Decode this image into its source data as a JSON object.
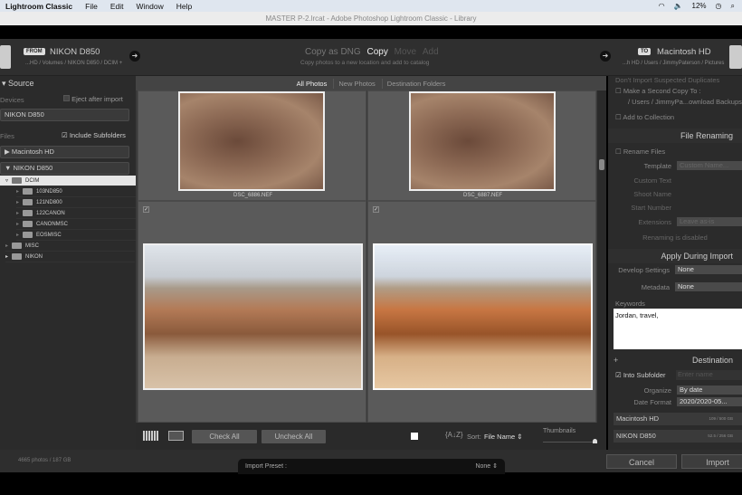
{
  "menubar": {
    "app": "Lightroom Classic",
    "items": [
      "File",
      "Edit",
      "Window",
      "Help"
    ],
    "battery": "12%"
  },
  "window_title": "MASTER P-2.lrcat - Adobe Photoshop Lightroom Classic - Library",
  "header": {
    "from_tag": "FROM",
    "from_source": "NIKON D850",
    "from_path": "...HD / Volumes / NIKON D850 / DCIM +",
    "modes": [
      "Copy as DNG",
      "Copy",
      "Move",
      "Add"
    ],
    "active_mode": "Copy",
    "mode_desc": "Copy photos to a new location and add to catalog",
    "to_tag": "TO",
    "to_dest": "Macintosh HD",
    "to_path": "...h HD / Users / JimmyPaterson / Pictures"
  },
  "source": {
    "title": "Source",
    "devices_label": "Devices",
    "eject_label": "Eject after import",
    "device": "NIKON D850",
    "files_label": "Files",
    "include_subfolders": "Include Subfolders",
    "include_checked": true,
    "volumes": [
      "Macintosh HD",
      "NIKON D850"
    ],
    "folders": [
      {
        "name": "DCIM",
        "level": 1,
        "selected": true
      },
      {
        "name": "103ND850",
        "level": 2
      },
      {
        "name": "121ND800",
        "level": 2
      },
      {
        "name": "122CANON",
        "level": 2
      },
      {
        "name": "CANONMSC",
        "level": 2
      },
      {
        "name": "EOSMISC",
        "level": 2
      },
      {
        "name": "MISC",
        "level": 1
      },
      {
        "name": "NIKON",
        "level": 1
      }
    ]
  },
  "grid": {
    "tabs": [
      "All Photos",
      "New Photos",
      "Destination Folders"
    ],
    "active_tab": "All Photos",
    "photos": [
      {
        "name": "DSC_6886.NEF",
        "checked": true
      },
      {
        "name": "DSC_6887.NEF",
        "checked": true
      },
      {
        "checked": true
      },
      {
        "checked": true
      }
    ]
  },
  "toolbar": {
    "check_all": "Check All",
    "uncheck_all": "Uncheck All",
    "sort_label": "Sort:",
    "sort_value": "File Name",
    "thumbnails": "Thumbnails"
  },
  "right": {
    "dup": "Don't Import Suspected Duplicates",
    "second_copy": "Make a Second Copy To :",
    "second_copy_path": "/ Users / JimmyPa...ownload Backups",
    "add_collection": "Add to Collection",
    "file_renaming": "File Renaming",
    "rename_files": "Rename Files",
    "template_label": "Template",
    "template_value": "Custom Name...",
    "custom_text": "Custom Text",
    "shoot_name": "Shoot Name",
    "start_number": "Start Number",
    "extensions_label": "Extensions",
    "extensions_value": "Leave as-is",
    "renaming_disabled": "Renaming is disabled",
    "apply": "Apply During Import",
    "develop_label": "Develop Settings",
    "develop_value": "None",
    "metadata_label": "Metadata",
    "metadata_value": "None",
    "keywords_label": "Keywords",
    "keywords": "Jordan, travel,",
    "destination": "Destination",
    "into_subfolder": "Into Subfolder",
    "subfolder_placeholder": "Enter name",
    "organize_label": "Organize",
    "organize_value": "By date",
    "date_format_label": "Date Format",
    "date_format_value": "2020/2020-05...",
    "volumes": [
      {
        "name": "Macintosh HD",
        "usage": "109 / 500 GB"
      },
      {
        "name": "NIKON D850",
        "usage": "52.5 / 256 GB"
      }
    ]
  },
  "bottom": {
    "count": "4665 photos / 187 GB",
    "cancel": "Cancel",
    "import": "Import",
    "preset_label": "Import Preset :",
    "preset_value": "None"
  }
}
